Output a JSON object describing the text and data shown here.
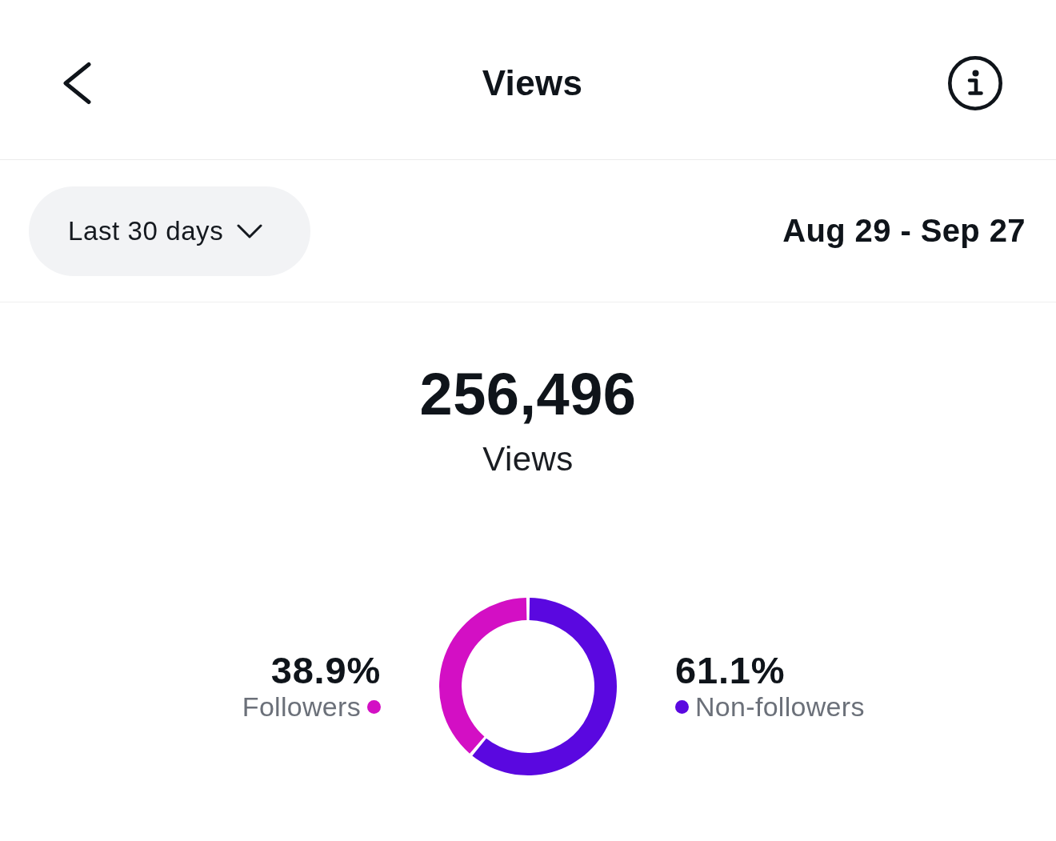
{
  "header": {
    "title": "Views"
  },
  "range": {
    "label": "Last 30 days",
    "dates": "Aug 29 - Sep 27"
  },
  "summary": {
    "total": "256,496",
    "caption": "Views"
  },
  "breakdown": {
    "chart_data": {
      "type": "donut",
      "categories": [
        "Followers",
        "Non-followers"
      ],
      "values": [
        38.9,
        61.1
      ],
      "value_labels": [
        "38.9%",
        "61.1%"
      ]
    },
    "legend": [
      {
        "color": "#d30fc4"
      },
      {
        "color": "#5a08e0"
      }
    ]
  }
}
